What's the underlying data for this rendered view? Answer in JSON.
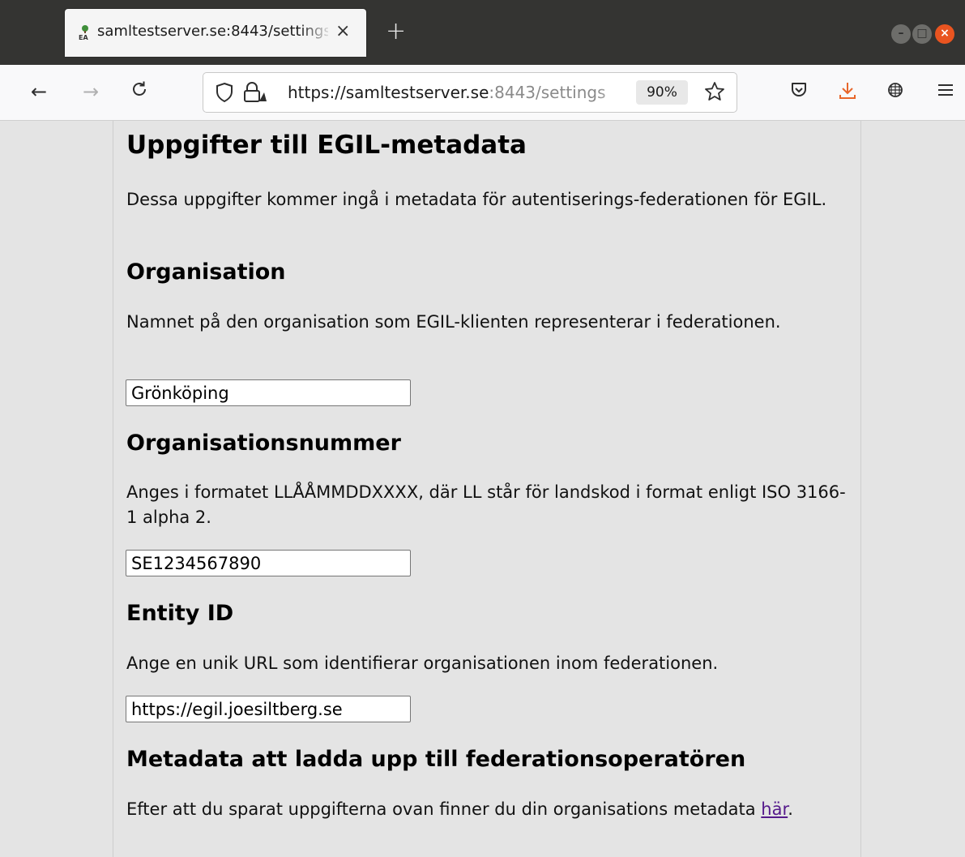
{
  "browser": {
    "tab_title": "samltestserver.se:8443/settings",
    "url_host": "https://samltestserver.se",
    "url_rest": ":8443/settings",
    "zoom": "90%"
  },
  "page": {
    "title": "Uppgifter till EGIL-metadata",
    "intro": "Dessa uppgifter kommer ingå i metadata för autentiserings-federationen för EGIL.",
    "organisation": {
      "heading": "Organisation",
      "description": "Namnet på den organisation som EGIL-klienten representerar i federationen.",
      "value": "Grönköping"
    },
    "orgnumber": {
      "heading": "Organisationsnummer",
      "description": "Anges i formatet LLÅÅMMDDXXXX, där LL står för landskod i format enligt ISO 3166-1 alpha 2.",
      "value": "SE1234567890"
    },
    "entity": {
      "heading": "Entity ID",
      "description": "Ange en unik URL som identifierar organisationen inom federationen.",
      "value": "https://egil.joesiltberg.se"
    },
    "metadata": {
      "heading": "Metadata att ladda upp till federationsoperatören",
      "text_before": "Efter att du sparat uppgifterna ovan finner du din organisations metadata ",
      "link": "här",
      "text_after": "."
    }
  }
}
